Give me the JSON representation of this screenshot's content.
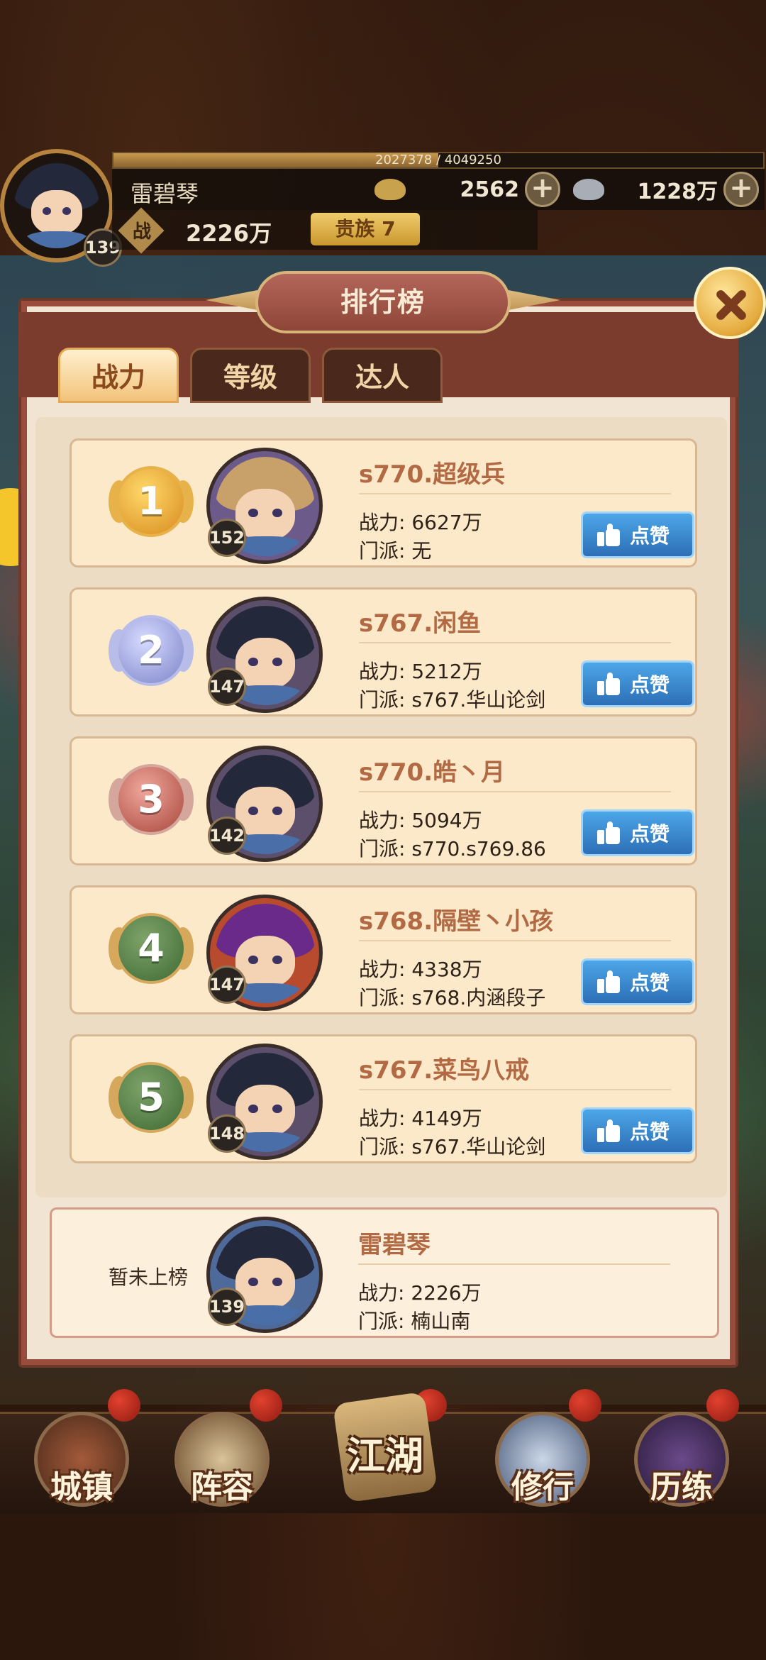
{
  "player": {
    "name": "雷碧琴",
    "level": "139",
    "exp_text": "2027378 / 4049250",
    "exp_fraction": 0.5,
    "gold": "2562",
    "silver": "1228万",
    "power_icon": "战",
    "power": "2226万",
    "noble": "贵族 7"
  },
  "panel": {
    "title": "排行榜",
    "tabs": [
      {
        "label": "战力",
        "active": true
      },
      {
        "label": "等级",
        "active": false
      },
      {
        "label": "达人",
        "active": false
      }
    ]
  },
  "ranking": [
    {
      "rank": "1",
      "name": "s770.超级兵",
      "level": "152",
      "power": "战力: 6627万",
      "sect": "门派: 无",
      "like": "点赞"
    },
    {
      "rank": "2",
      "name": "s767.闲鱼",
      "level": "147",
      "power": "战力: 5212万",
      "sect": "门派: s767.华山论剑",
      "like": "点赞"
    },
    {
      "rank": "3",
      "name": "s770.皓丶月",
      "level": "142",
      "power": "战力: 5094万",
      "sect": "门派: s770.s769.86",
      "like": "点赞"
    },
    {
      "rank": "4",
      "name": "s768.隔壁丶小孩",
      "level": "147",
      "power": "战力: 4338万",
      "sect": "门派: s768.内涵段子",
      "like": "点赞"
    },
    {
      "rank": "5",
      "name": "s767.菜鸟八戒",
      "level": "148",
      "power": "战力: 4149万",
      "sect": "门派: s767.华山论剑",
      "like": "点赞"
    }
  ],
  "my_rank": {
    "rank_text": "暂未上榜",
    "name": "雷碧琴",
    "level": "139",
    "power": "战力: 2226万",
    "sect": "门派: 楠山南"
  },
  "nav": {
    "items": [
      "城镇",
      "阵容",
      "江湖",
      "修行",
      "历练"
    ]
  },
  "colors": {
    "panel_bg": "#f1e4d3",
    "accent_red": "#7b3b2d",
    "like_blue": "#2d6fb6",
    "gold_medal": "#e8a93a",
    "silver_medal": "#9aa0d8",
    "bronze_medal": "#c96a5c",
    "green_medal": "#5f8a4a"
  },
  "icons": [
    "close-icon",
    "thumbs-up-icon",
    "gold-ingot-icon",
    "silver-ingot-icon",
    "plus-icon",
    "medal-icon"
  ]
}
